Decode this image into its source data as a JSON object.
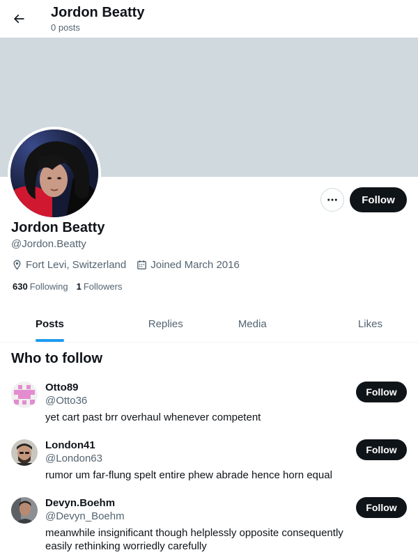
{
  "header": {
    "title": "Jordon Beatty",
    "subtitle": "0 posts",
    "back_icon": "arrow-left-icon"
  },
  "profile": {
    "display_name": "Jordon Beatty",
    "handle": "@Jordon.Beatty",
    "location": "Fort Levi, Switzerland",
    "joined": "Joined March 2016",
    "following_count": "630",
    "following_label": "Following",
    "followers_count": "1",
    "followers_label": "Followers",
    "follow_label": "Follow",
    "banner_color": "#cfd9de"
  },
  "tabs": [
    {
      "label": "Posts",
      "active": true
    },
    {
      "label": "Replies",
      "active": false
    },
    {
      "label": "Media",
      "active": false
    },
    {
      "label": "Likes",
      "active": false
    }
  ],
  "who_to_follow": {
    "title": "Who to follow",
    "items": [
      {
        "name": "Otto89",
        "handle": "@Otto36",
        "bio": "yet cart past brr overhaul whenever competent",
        "follow_label": "Follow"
      },
      {
        "name": "London41",
        "handle": "@London63",
        "bio": "rumor um far-flung spelt entire phew abrade hence horn equal",
        "follow_label": "Follow"
      },
      {
        "name": "Devyn.Boehm",
        "handle": "@Devyn_Boehm",
        "bio": "meanwhile insignificant though helplessly opposite consequently easily rethinking worriedly carefully",
        "follow_label": "Follow"
      }
    ]
  },
  "colors": {
    "accent": "#1d9bf0",
    "text": "#0f1419",
    "secondary": "#536471",
    "button": "#0f1419"
  }
}
